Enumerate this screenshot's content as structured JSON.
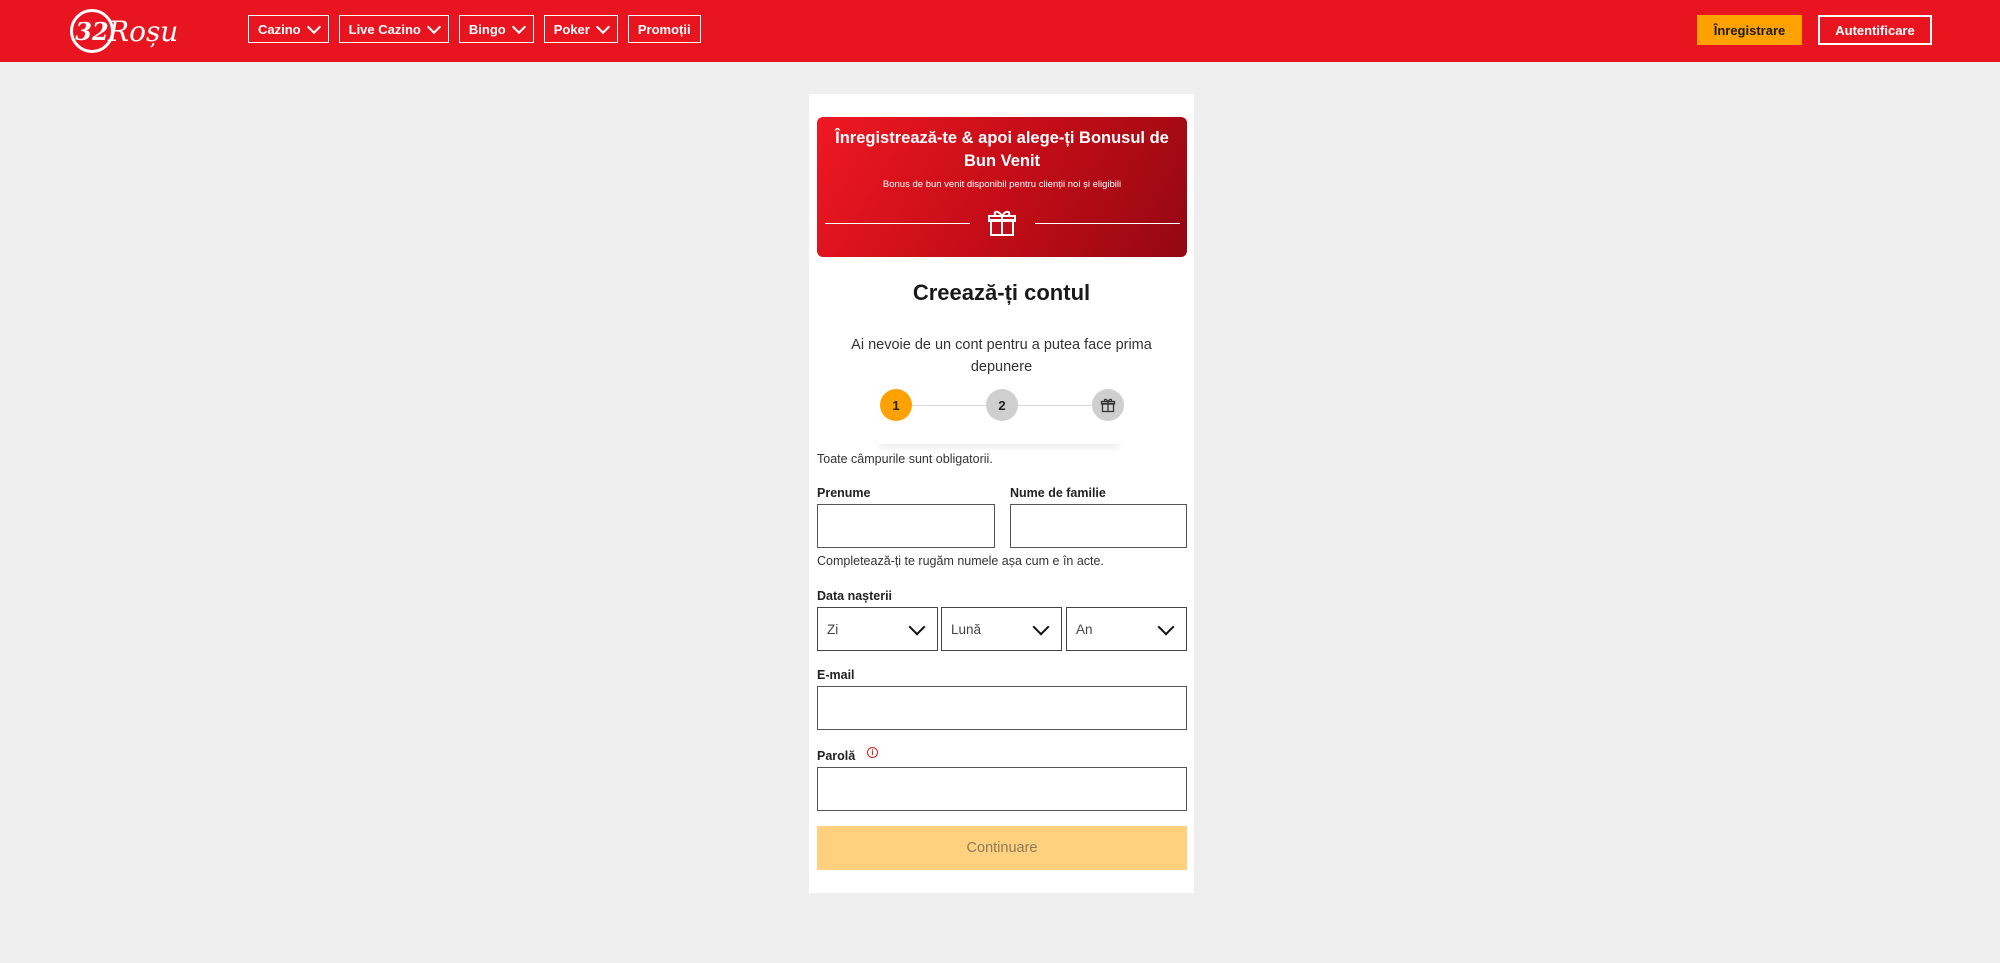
{
  "header": {
    "logo_number": "32",
    "logo_word": "Roșu",
    "nav": [
      {
        "label": "Cazino",
        "has_dropdown": true
      },
      {
        "label": "Live Cazino",
        "has_dropdown": true
      },
      {
        "label": "Bingo",
        "has_dropdown": true
      },
      {
        "label": "Poker",
        "has_dropdown": true
      },
      {
        "label": "Promoții",
        "has_dropdown": false
      }
    ],
    "register_label": "Înregistrare",
    "login_label": "Autentificare"
  },
  "banner": {
    "title": "Înregistrează-te & apoi alege-ți Bonusul de Bun Venit",
    "subtitle": "Bonus de bun venit disponibil pentru clienții noi și eligibili",
    "icon": "gift-icon"
  },
  "form": {
    "title": "Creează-ți contul",
    "subtitle": "Ai nevoie de un cont pentru a putea face prima depunere",
    "steps": [
      "1",
      "2"
    ],
    "required_note": "Toate câmpurile sunt obligatorii.",
    "first_name_label": "Prenume",
    "last_name_label": "Nume de familie",
    "name_help": "Completează-ți te rugăm numele așa cum e în acte.",
    "dob_label": "Data nașterii",
    "dob_day": "Zi",
    "dob_month": "Lună",
    "dob_year": "An",
    "email_label": "E-mail",
    "password_label": "Parolă",
    "continue_label": "Continuare"
  },
  "colors": {
    "brand_red": "#e8141f",
    "accent_orange": "#ffa200",
    "disabled_button": "#ffd17f",
    "page_bg": "#efefef"
  }
}
